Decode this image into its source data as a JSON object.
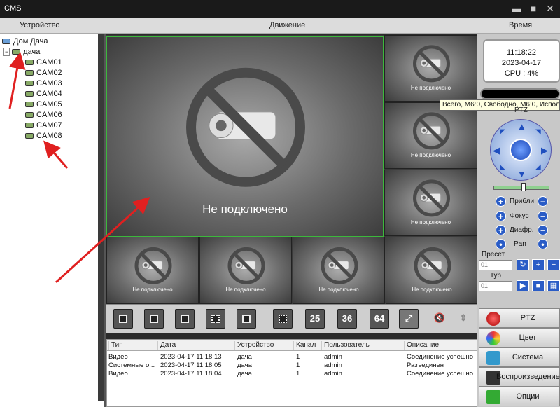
{
  "window": {
    "title": "CMS",
    "min": "▬",
    "max": "■",
    "close": "✕"
  },
  "menu": {
    "device": "Устройство",
    "motion": "Движение",
    "time": "Время"
  },
  "tree": {
    "root": "Дом Дача",
    "group": "дача",
    "cams": [
      "CAM01",
      "CAM02",
      "CAM03",
      "CAM04",
      "CAM05",
      "CAM06",
      "CAM07",
      "CAM08"
    ]
  },
  "tiles": {
    "not_connected": "Не подключено"
  },
  "layout_buttons": [
    "25",
    "36",
    "64"
  ],
  "clock": {
    "time": "11:18:22",
    "date": "2023-04-17",
    "cpu": "CPU : 4%"
  },
  "status_tooltip": "Всего, M6:0, Свободно, M6:0, Испол",
  "ptz": {
    "label": "PTZ",
    "zoom": "Прибли",
    "focus": "Фокус",
    "iris": "Диафр.",
    "pan": "Pan",
    "preset": "Пресет",
    "tour": "Тур",
    "preset_value": "01",
    "tour_value": "01"
  },
  "log": {
    "headers": [
      "Тип",
      "Дата",
      "Устройство",
      "Канал",
      "Пользователь",
      "Описание"
    ],
    "rows": [
      [
        "Видео",
        "2023-04-17 11:18:13",
        "дача",
        "1",
        "admin",
        "Соединение успешно"
      ],
      [
        "Системные о...",
        "2023-04-17 11:18:05",
        "дача",
        "1",
        "admin",
        "Разъединен"
      ],
      [
        "Видео",
        "2023-04-17 11:18:04",
        "дача",
        "1",
        "admin",
        "Соединение успешно"
      ]
    ]
  },
  "nav": {
    "ptz": "PTZ",
    "color": "Цвет",
    "system": "Система",
    "playback": "Воспроизведение",
    "options": "Опции"
  },
  "colors": {
    "active_border": "#3cb83c",
    "accent": "#2a5cc6",
    "arrow": "#e02020"
  }
}
